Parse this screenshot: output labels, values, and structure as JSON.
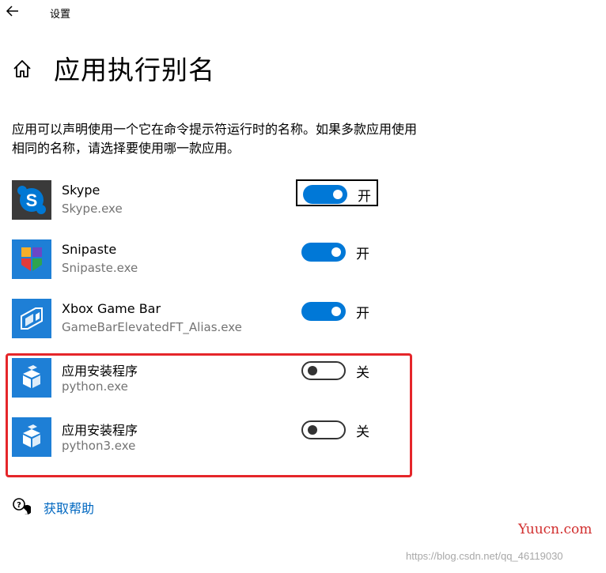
{
  "window": {
    "title": "设置"
  },
  "page": {
    "title": "应用执行别名",
    "description_line1": "应用可以声明使用一个它在命令提示符运行时的名称。如果多款应用使用",
    "description_line2": "相同的名称，请选择要使用哪一款应用。"
  },
  "apps": [
    {
      "name": "Skype",
      "exe": "Skype.exe",
      "state": "开",
      "on": true,
      "focused": true,
      "icon": "skype-icon"
    },
    {
      "name": "Snipaste",
      "exe": "Snipaste.exe",
      "state": "开",
      "on": true,
      "focused": false,
      "icon": "snipaste-icon"
    },
    {
      "name": "Xbox Game Bar",
      "exe": "GameBarElevatedFT_Alias.exe",
      "state": "开",
      "on": true,
      "focused": false,
      "icon": "xbox-game-bar-icon"
    },
    {
      "name": "应用安装程序",
      "exe": "python.exe",
      "state": "关",
      "on": false,
      "focused": false,
      "icon": "app-installer-icon"
    },
    {
      "name": "应用安装程序",
      "exe": "python3.exe",
      "state": "关",
      "on": false,
      "focused": false,
      "icon": "app-installer-icon"
    }
  ],
  "help": {
    "label": "获取帮助"
  },
  "watermark": {
    "brand": "Yuucn.com",
    "url": "https://blog.csdn.net/qq_46119030"
  },
  "colors": {
    "accent": "#0078d7",
    "highlight": "#e5262a",
    "link": "#0067c0",
    "skype": "#0078d4"
  }
}
